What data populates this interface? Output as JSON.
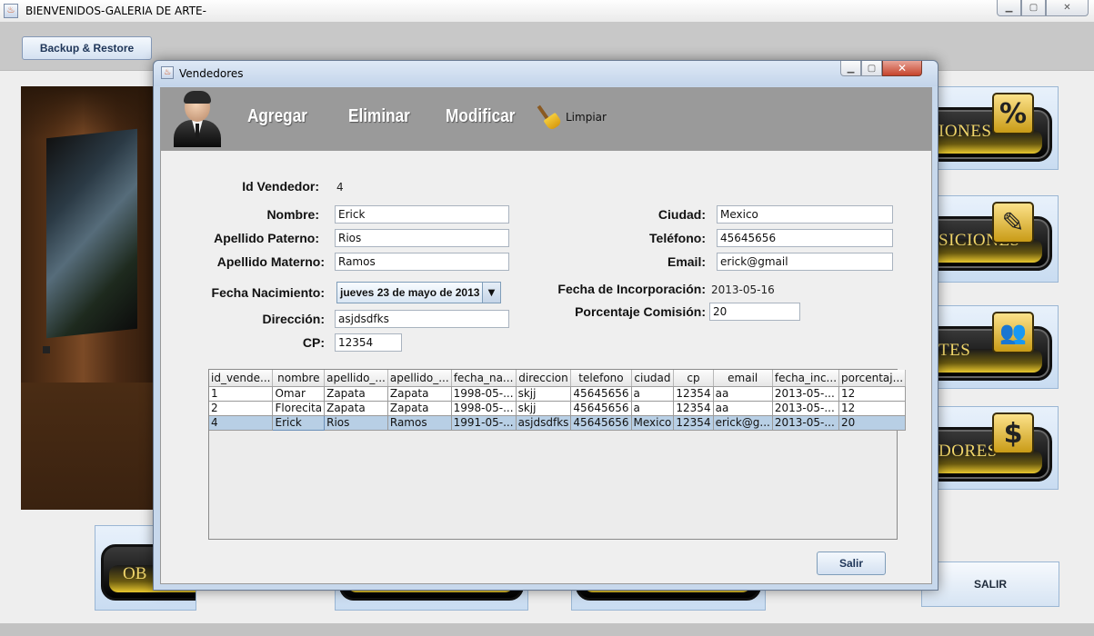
{
  "main_window": {
    "title": "BIENVENIDOS-GALERIA DE ARTE-",
    "backup_button": "Backup & Restore",
    "right_menu": [
      {
        "label": "IONES",
        "icon": "percent-icon",
        "glyph": "%"
      },
      {
        "label": "SICIONES",
        "icon": "newspaper-pen-icon",
        "glyph": "✎"
      },
      {
        "label": "TES",
        "icon": "people-icon",
        "glyph": "👥"
      },
      {
        "label": "DORES",
        "icon": "dollar-person-icon",
        "glyph": "$"
      }
    ],
    "bottom_menu": [
      {
        "label": "OB"
      },
      {
        "label": ""
      },
      {
        "label": ""
      }
    ],
    "exit_button": "SALIR"
  },
  "dialog": {
    "title": "Vendedores",
    "toolbar": {
      "add": "Agregar",
      "delete": "Eliminar",
      "modify": "Modificar",
      "clear": "Limpiar"
    },
    "form": {
      "id_label": "Id Vendedor:",
      "id_value": "4",
      "nombre_label": "Nombre:",
      "nombre_value": "Erick",
      "apellido_paterno_label": "Apellido Paterno:",
      "apellido_paterno_value": "Rios",
      "apellido_materno_label": "Apellido Materno:",
      "apellido_materno_value": "Ramos",
      "fecha_nacimiento_label": "Fecha Nacimiento:",
      "fecha_nacimiento_value": "jueves 23 de mayo de 2013",
      "direccion_label": "Dirección:",
      "direccion_value": "asjdsdfks",
      "cp_label": "CP:",
      "cp_value": "12354",
      "ciudad_label": "Ciudad:",
      "ciudad_value": "Mexico",
      "telefono_label": "Teléfono:",
      "telefono_value": "45645656",
      "email_label": "Email:",
      "email_value": "erick@gmail",
      "fecha_incorporacion_label": "Fecha de Incorporación:",
      "fecha_incorporacion_value": "2013-05-16",
      "porcentaje_label": "Porcentaje Comisión:",
      "porcentaje_value": "20"
    },
    "table": {
      "columns": [
        "id_vende...",
        "nombre",
        "apellido_...",
        "apellido_...",
        "fecha_na...",
        "direccion",
        "telefono",
        "ciudad",
        "cp",
        "email",
        "fecha_inc...",
        "porcentaj..."
      ],
      "rows": [
        [
          "1",
          "Omar",
          "Zapata",
          "Zapata",
          "1998-05-...",
          "skjj",
          "45645656",
          "a",
          "12354",
          "aa",
          "2013-05-...",
          "12"
        ],
        [
          "2",
          "Florecita",
          "Zapata",
          "Zapata",
          "1998-05-...",
          "skjj",
          "45645656",
          "a",
          "12354",
          "aa",
          "2013-05-...",
          "12"
        ],
        [
          "4",
          "Erick",
          "Rios",
          "Ramos",
          "1991-05-...",
          "asjdsdfks",
          "45645656",
          "Mexico",
          "12354",
          "erick@g...",
          "2013-05-...",
          "20"
        ]
      ],
      "selected_row": 2
    },
    "exit_button": "Salir"
  }
}
